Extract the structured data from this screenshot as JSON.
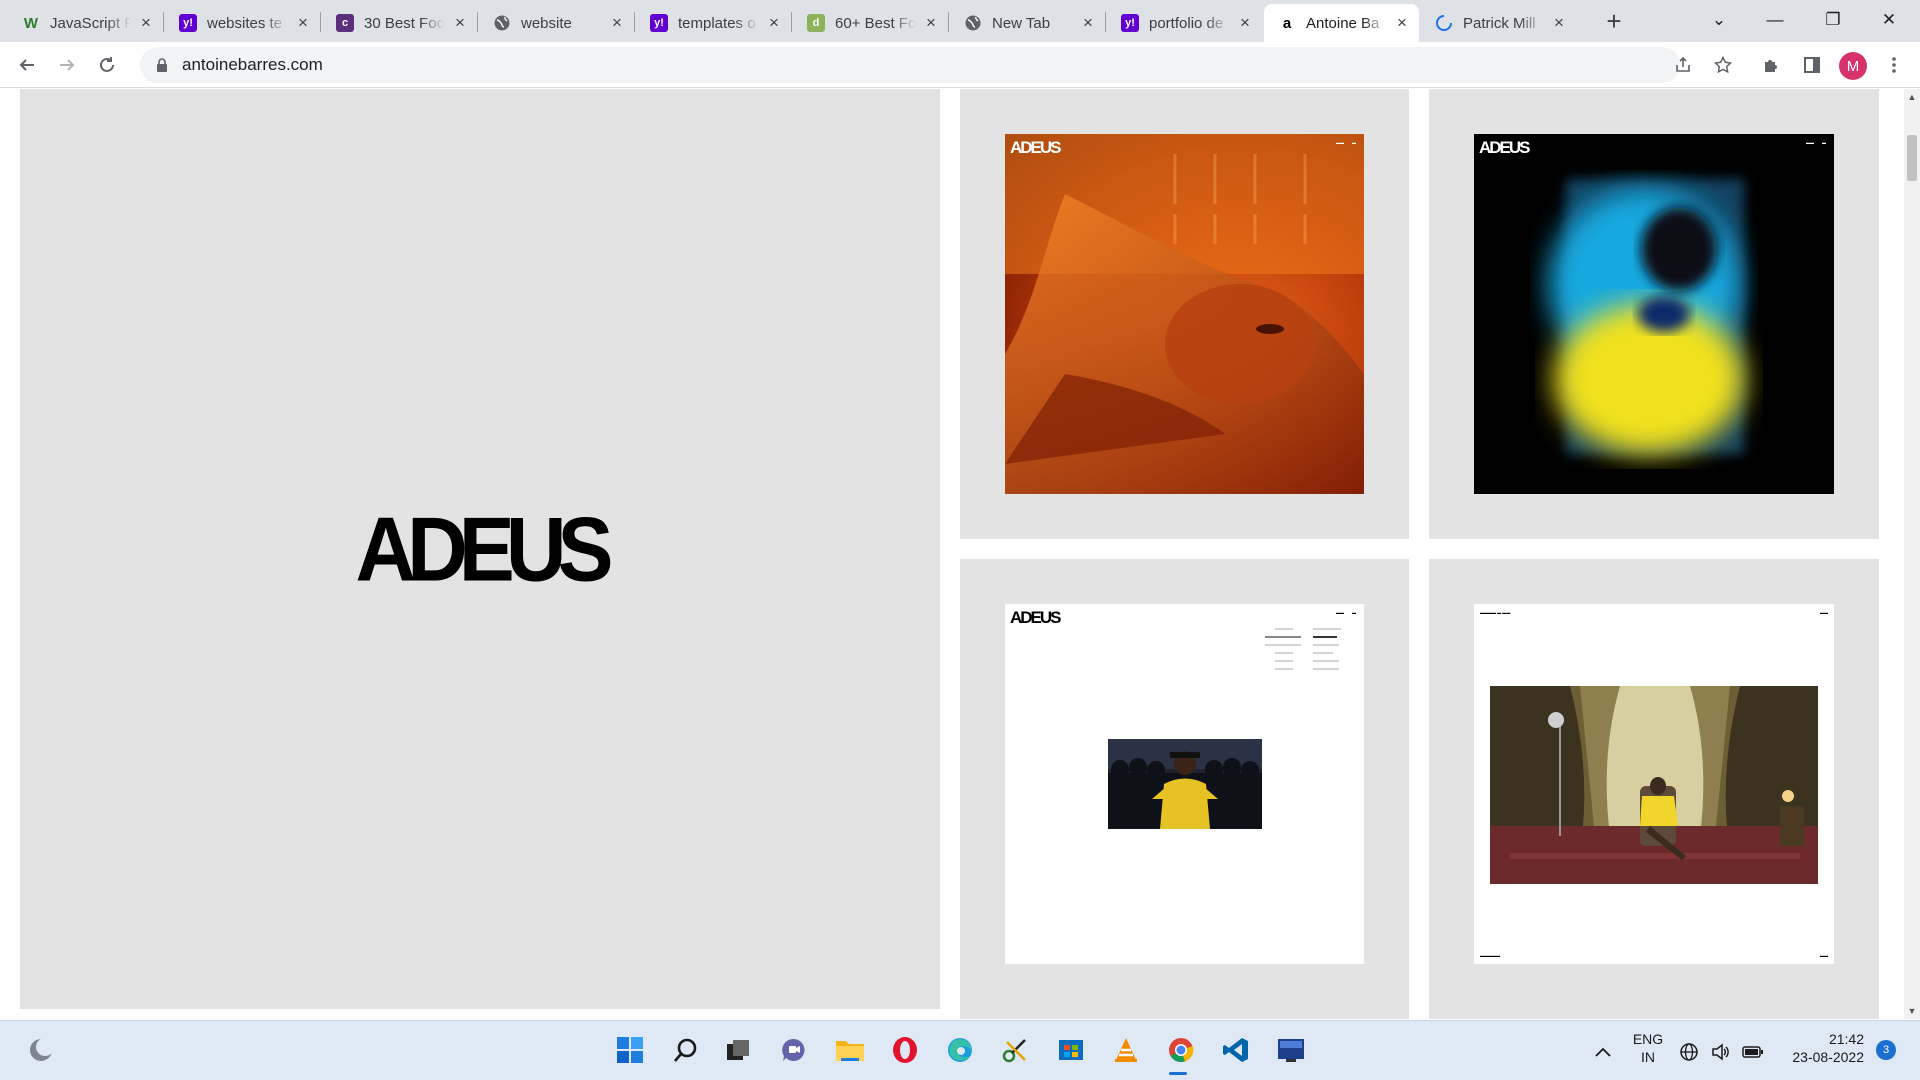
{
  "browser": {
    "tabs": [
      {
        "title": "JavaScript F",
        "favicon": "w-icon",
        "fav_color": "#2e7d32",
        "fav_text": "W"
      },
      {
        "title": "websites te",
        "favicon": "yahoo-icon",
        "fav_color": "#6001d2",
        "fav_text": "y!"
      },
      {
        "title": "30 Best Foo",
        "favicon": "colorlib-icon",
        "fav_color": "#5b2e7e",
        "fav_text": "c"
      },
      {
        "title": "website",
        "favicon": "globe-icon",
        "fav_color": "#5f6368",
        "fav_text": ""
      },
      {
        "title": "templates o",
        "favicon": "yahoo-icon",
        "fav_color": "#6001d2",
        "fav_text": "y!"
      },
      {
        "title": "60+ Best Fo",
        "favicon": "d-icon",
        "fav_color": "#8bb35a",
        "fav_text": "d"
      },
      {
        "title": "New Tab",
        "favicon": "globe-icon",
        "fav_color": "#5f6368",
        "fav_text": ""
      },
      {
        "title": "portfolio de",
        "favicon": "yahoo-icon",
        "fav_color": "#6001d2",
        "fav_text": "y!"
      },
      {
        "title": "Antoine Ba",
        "favicon": "a-icon",
        "fav_color": "#ffffff",
        "fav_text": "a",
        "active": true
      },
      {
        "title": "Patrick Mill",
        "favicon": "loading-icon",
        "fav_color": "#1a73e8",
        "fav_text": ""
      }
    ],
    "new_tab_glyph": "+",
    "window_controls": {
      "dropdown": "⌄",
      "minimize": "—",
      "restore": "❐",
      "close": "✕"
    },
    "address_bar": {
      "url": "antoinebarres.com"
    },
    "profile_initial": "M"
  },
  "page": {
    "hero_logo": "ADEUS",
    "cards": [
      {
        "logo": "ADEUS",
        "theme": "orange-portrait"
      },
      {
        "logo": "ADEUS",
        "theme": "blue-yellow-blur"
      },
      {
        "logo": "ADEUS",
        "theme": "white-list-layout"
      },
      {
        "logo": "",
        "theme": "white-room-scene"
      }
    ]
  },
  "taskbar": {
    "apps": [
      "start-icon",
      "search-icon",
      "task-view-icon",
      "teams-chat-icon",
      "file-explorer-icon",
      "opera-icon",
      "edge-icon",
      "app-icon",
      "store-icon",
      "vlc-icon",
      "chrome-icon",
      "vscode-icon",
      "dev-cpp-icon"
    ],
    "language_top": "ENG",
    "language_bottom": "IN",
    "time": "21:42",
    "date": "23-08-2022",
    "notification_count": "3"
  }
}
